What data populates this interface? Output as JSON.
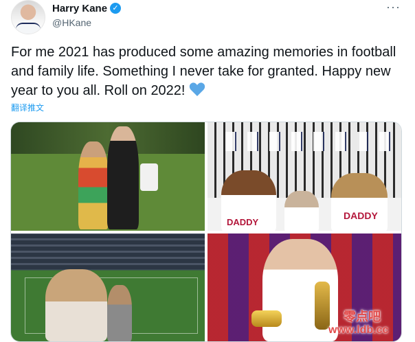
{
  "tweet": {
    "author_name": "Harry Kane",
    "handle": "@HKane",
    "text": "For me 2021 has produced some amazing memories in football and family life. Something I never take for granted. Happy new year to you all. Roll on 2022!",
    "translate_label": "翻译推文"
  },
  "media": {
    "shirt_names": [
      "DADDY",
      "DADDY"
    ]
  },
  "watermark": {
    "title": "零点吧",
    "url": "www.ldb.cc"
  },
  "colors": {
    "accent": "#1d9bf0",
    "heart": "#5aa7e6",
    "muted": "#536471"
  }
}
